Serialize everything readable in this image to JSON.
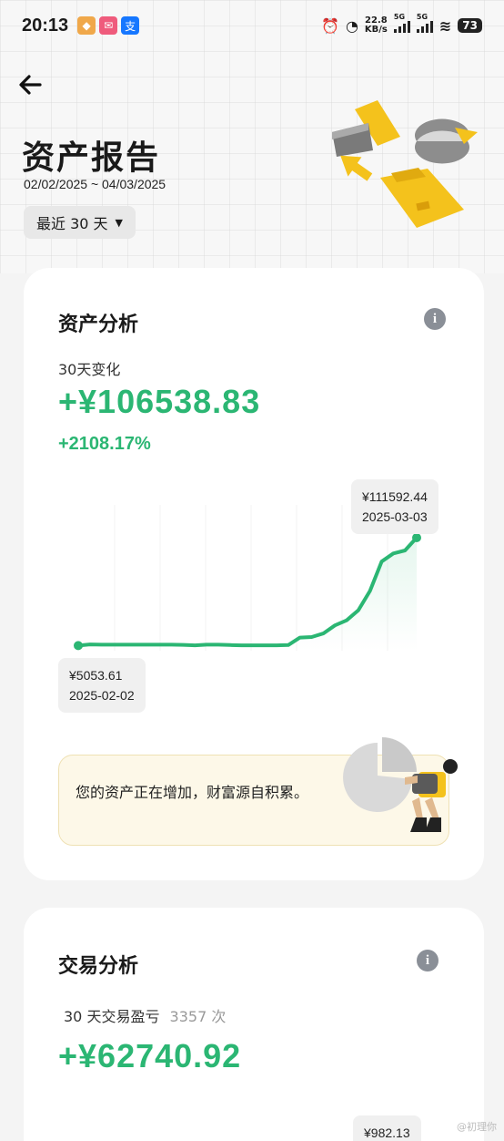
{
  "status_bar": {
    "time": "20:13",
    "speed_value": "22.8",
    "speed_unit": "KB/s",
    "net1": "5G",
    "net2": "5G",
    "battery": "73"
  },
  "header": {
    "title": "资产报告",
    "date_range": "02/02/2025 ~ 04/03/2025",
    "period": "最近 30 天"
  },
  "asset_card": {
    "title": "资产分析",
    "change_label": "30天变化",
    "change_amount": "+¥106538.83",
    "change_percent": "+2108.17%",
    "end_tip": {
      "value": "¥111592.44",
      "date": "2025-03-03"
    },
    "start_tip": {
      "value": "¥5053.61",
      "date": "2025-02-02"
    },
    "insight": "您的资产正在增加，财富源自积累。"
  },
  "trade_card": {
    "title": "交易分析",
    "pnl_label": "30 天交易盈亏",
    "trade_count": "3357 次",
    "pnl_amount": "+¥62740.92",
    "partial_tip": "¥982.13"
  },
  "watermark": "@初理你",
  "colors": {
    "accent_green": "#2bb673",
    "card_bg": "#ffffff",
    "insight_bg": "#fdf8e8"
  },
  "chart_data": {
    "type": "line",
    "x": [
      "2025-02-02",
      "2025-02-03",
      "2025-02-04",
      "2025-02-05",
      "2025-02-06",
      "2025-02-07",
      "2025-02-08",
      "2025-02-09",
      "2025-02-10",
      "2025-02-11",
      "2025-02-12",
      "2025-02-13",
      "2025-02-14",
      "2025-02-15",
      "2025-02-16",
      "2025-02-17",
      "2025-02-18",
      "2025-02-19",
      "2025-02-20",
      "2025-02-21",
      "2025-02-22",
      "2025-02-23",
      "2025-02-24",
      "2025-02-25",
      "2025-02-26",
      "2025-02-27",
      "2025-02-28",
      "2025-03-01",
      "2025-03-02",
      "2025-03-03"
    ],
    "values": [
      5053.61,
      6200,
      5900,
      5900,
      5900,
      5900,
      5900,
      5900,
      5900,
      5800,
      5300,
      5900,
      5900,
      5600,
      5300,
      5300,
      5300,
      5300,
      5600,
      13000,
      13500,
      17000,
      25000,
      30000,
      40000,
      59000,
      88000,
      96000,
      99000,
      111592.44
    ],
    "annotations": [
      {
        "x": "2025-02-02",
        "label": "¥5053.61"
      },
      {
        "x": "2025-03-03",
        "label": "¥111592.44"
      }
    ]
  }
}
